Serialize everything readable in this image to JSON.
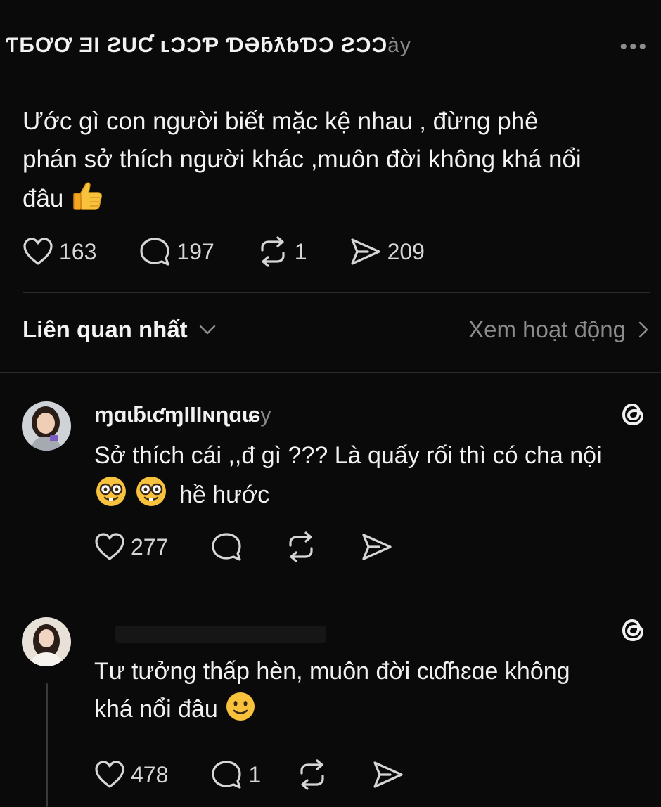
{
  "post": {
    "header_text": "ƬƂƠƠ ƎƖ ƧUƇ ʟƆƆƤ ƊƏƃƛƅƊƆ ƧƆƆ",
    "header_faded_text": "ày",
    "text_line_1": "Ước gì con người biết mặc kệ nhau , đừng phê",
    "text_line_2": "phán sở thích người khác ,muôn đời không khá nổi",
    "text_line_3": "đâu",
    "likes": "163",
    "comments": "197",
    "reposts": "1",
    "shares": "209"
  },
  "sort": {
    "label": "Liên quan nhất",
    "activity_link": "Xem hoạt động"
  },
  "comments": [
    {
      "username": "ɱɑɩƃɩƈɱƖƖƖɴɳɑɩɕ",
      "username_faded": "y",
      "text_line_1": "Sở thích cái ,,đ gì ??? Là quấy rối thì có cha nội",
      "text_line_2": "hề hước",
      "likes": "277"
    },
    {
      "username": "",
      "text_line_1": "Tư tưởng thấp hèn, muôn đời cɩɗɦɛɑe không",
      "text_line_2": "khá nổi đâu",
      "likes": "478",
      "comments": "1"
    }
  ],
  "colors": {
    "background": "#0a0a0a",
    "text": "#f3f3f3",
    "muted": "#8c8c8c",
    "divider": "#2b2b2b"
  },
  "icons": [
    "more-icon",
    "heart-icon",
    "comment-icon",
    "repost-icon",
    "share-icon",
    "chevron-down-icon",
    "chevron-right-icon",
    "threads-icon",
    "thumbs-up-emoji",
    "nerd-face-emoji",
    "smiling-face-emoji"
  ]
}
